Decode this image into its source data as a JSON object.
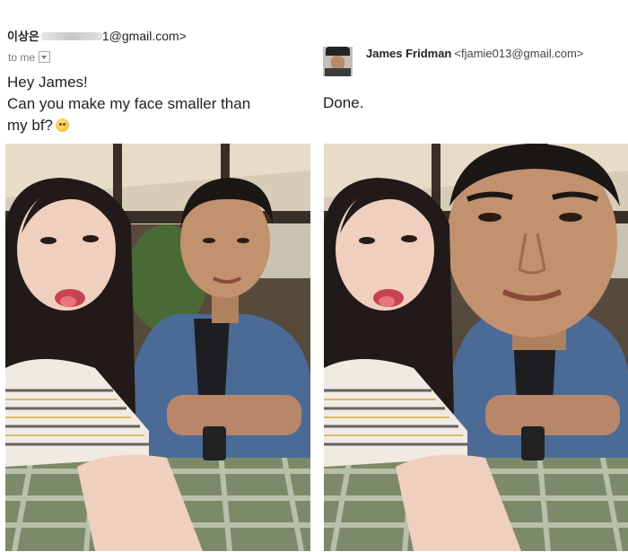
{
  "left_email": {
    "sender_name": "이상은",
    "sender_email_suffix": "1@gmail.com>",
    "recipient_label": "to me",
    "message_lines": [
      "Hey James!",
      "Can you make my face smaller than",
      "my bf?"
    ],
    "emoji": "crying-face-emoji"
  },
  "right_email": {
    "sender_name": "James Fridman",
    "sender_email": "<fjamie013@gmail.com>",
    "message": "Done."
  },
  "colors": {
    "text": "#222222",
    "muted": "#777777",
    "bg": "#ffffff"
  }
}
